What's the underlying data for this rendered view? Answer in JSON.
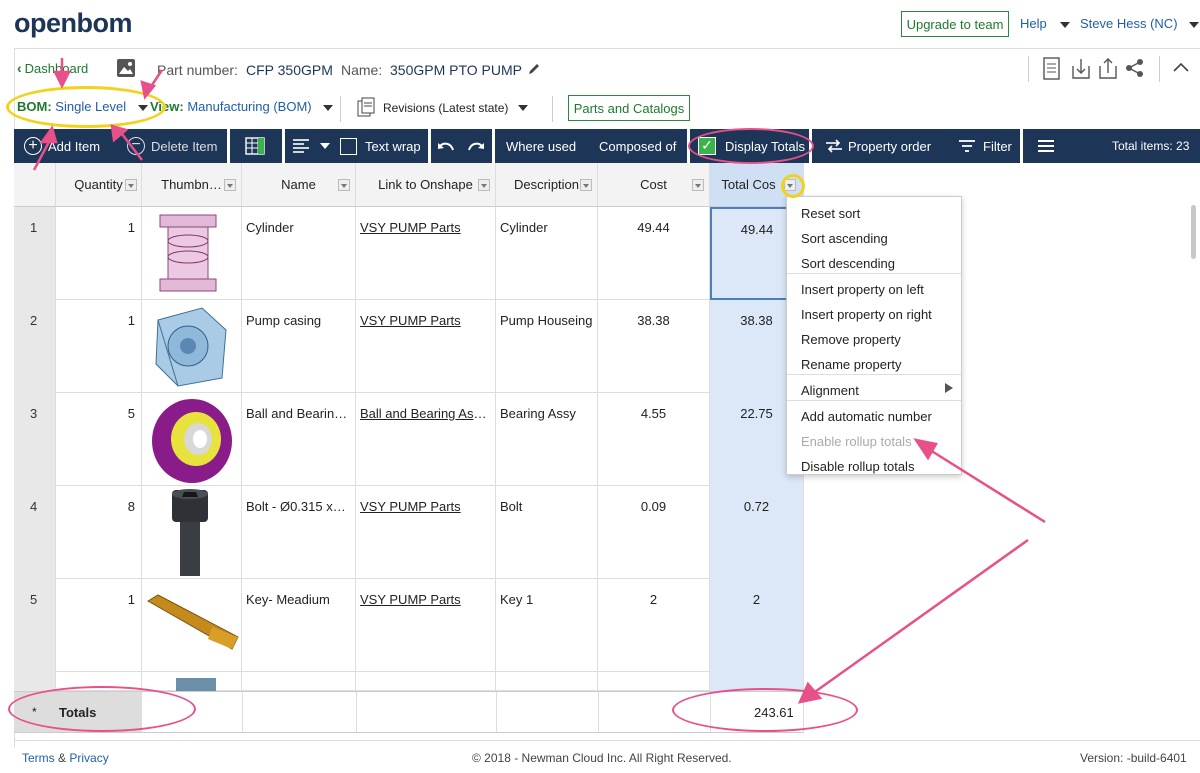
{
  "app": {
    "logo": "openbom"
  },
  "topbar": {
    "upgrade": "Upgrade to team",
    "help": "Help",
    "user": "Steve Hess (NC)"
  },
  "header": {
    "back": "Dashboard",
    "part_number_label": "Part number:",
    "part_number": "CFP 350GPM",
    "name_label": "Name:",
    "name": "350GPM PTO PUMP"
  },
  "bom_bar": {
    "bom_label": "BOM:",
    "bom_value": "Single Level",
    "view_label": "View:",
    "view_value": "Manufacturing (BOM)",
    "revisions": "Revisions (Latest state)",
    "parts_catalogs": "Parts and Catalogs"
  },
  "toolbar": {
    "add_item": "Add Item",
    "delete_item": "Delete Item",
    "text_wrap": "Text wrap",
    "where_used": "Where used",
    "composed_of": "Composed of",
    "display_totals": "Display Totals",
    "property_order": "Property order",
    "filter": "Filter",
    "total_items": "Total items: 23"
  },
  "columns": [
    "Quantity",
    "Thumbn…",
    "Name",
    "Link to Onshape",
    "Description",
    "Cost",
    "Total Cos"
  ],
  "rows": [
    {
      "n": "1",
      "qty": "1",
      "name": "Cylinder",
      "link": "VSY PUMP Parts",
      "desc": "Cylinder",
      "cost": "49.44",
      "total": "49.44"
    },
    {
      "n": "2",
      "qty": "1",
      "name": "Pump casing",
      "link": "VSY PUMP Parts",
      "desc": "Pump Houseing",
      "cost": "38.38",
      "total": "38.38"
    },
    {
      "n": "3",
      "qty": "5",
      "name": "Ball and Bearin…",
      "link": "Ball and Bearing Ass…",
      "desc": "Bearing Assy",
      "cost": "4.55",
      "total": "22.75"
    },
    {
      "n": "4",
      "qty": "8",
      "name": "Bolt - Ø0.315 x…",
      "link": "VSY PUMP Parts",
      "desc": "Bolt",
      "cost": "0.09",
      "total": "0.72"
    },
    {
      "n": "5",
      "qty": "1",
      "name": "Key- Meadium",
      "link": "VSY PUMP Parts",
      "desc": "Key 1",
      "cost": "2",
      "total": "2"
    }
  ],
  "totals": {
    "marker": "*",
    "label": "Totals",
    "value": "243.61"
  },
  "context_menu": [
    "Reset sort",
    "Sort ascending",
    "Sort descending",
    "Insert property on left",
    "Insert property on right",
    "Remove property",
    "Rename property",
    "Alignment",
    "Add automatic number",
    "Enable rollup totals",
    "Disable rollup totals"
  ],
  "footer": {
    "terms": "Terms",
    "amp": "&",
    "privacy": "Privacy",
    "copyright": "© 2018 - Newman Cloud Inc. All Right Reserved.",
    "version": "Version: -build-6401"
  },
  "colors": {
    "navy": "#1d3557",
    "green": "#1f7a2f",
    "annotation_pink": "#e8508a",
    "annotation_yellow": "#f2d21b",
    "total_col": "#dce8f7"
  }
}
